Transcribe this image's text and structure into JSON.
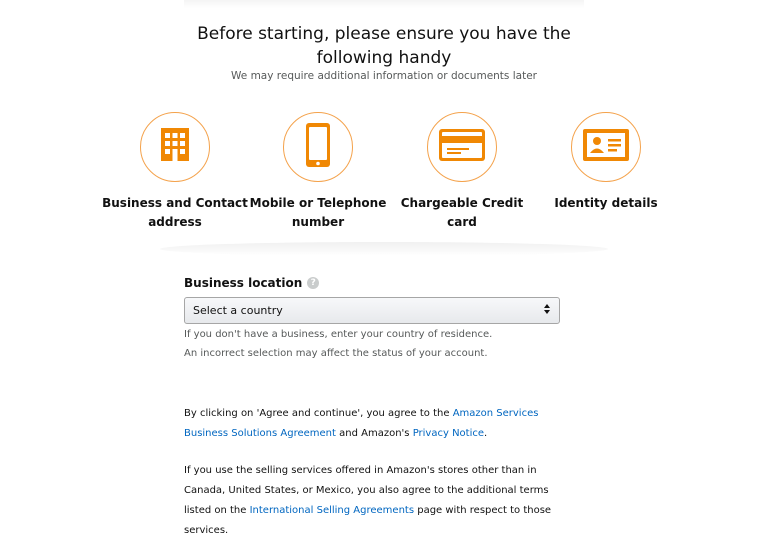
{
  "header": {
    "title": "Before starting, please ensure you have the following handy",
    "subtitle": "We may require additional information or documents later"
  },
  "requirements": [
    {
      "label": "Business and Contact address",
      "icon": "building-icon"
    },
    {
      "label": "Mobile or Telephone number",
      "icon": "mobile-phone-icon"
    },
    {
      "label": "Chargeable Credit card",
      "icon": "credit-card-icon"
    },
    {
      "label": "Identity details",
      "icon": "id-card-icon"
    }
  ],
  "location": {
    "label": "Business location",
    "help_glyph": "?",
    "select_value": "Select a country",
    "hint1": "If you don't have a business, enter your country of residence.",
    "hint2": "An incorrect selection may affect the status of your account."
  },
  "agreement": {
    "p1_pre": "By clicking on 'Agree and continue', you agree to the ",
    "p1_link1": "Amazon Services Business Solutions Agreement",
    "p1_mid": " and Amazon's ",
    "p1_link2": "Privacy Notice",
    "p1_post": ".",
    "p2_pre": "If you use the selling services offered in Amazon's stores other than in Canada, United States, or Mexico, you also agree to the additional terms listed on the ",
    "p2_link": "International Selling Agreements",
    "p2_post": " page with respect to those services."
  },
  "colors": {
    "accent": "#f3a847",
    "icon_fill": "#f08804",
    "link": "#0066c0",
    "muted_text": "#565959"
  }
}
